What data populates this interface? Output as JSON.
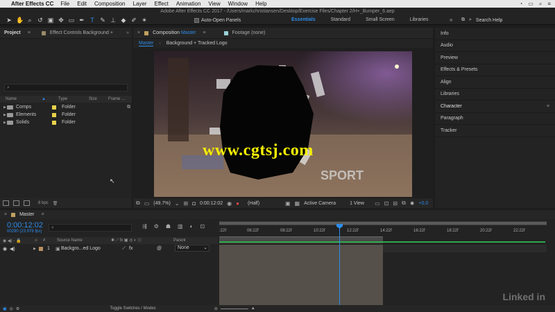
{
  "menubar": {
    "app": "After Effects CC",
    "items": [
      "File",
      "Edit",
      "Composition",
      "Layer",
      "Effect",
      "Animation",
      "View",
      "Window",
      "Help"
    ]
  },
  "toolbar": {
    "title": "Adobe After Effects CC 2017 - /Users/markchristiansen/Desktop/Exercise Files/Chapter 2/H+_Bumper_6.aep",
    "auto_open": "Auto-Open Panels",
    "workspaces": [
      "Essentials",
      "Standard",
      "Small Screen",
      "Libraries"
    ],
    "search_help": "Search Help"
  },
  "project": {
    "tab_project": "Project",
    "tab_effects": "Effect Controls Background +",
    "columns": [
      "Name",
      "Type",
      "Size",
      "Frame ..."
    ],
    "rows": [
      {
        "name": "Comps",
        "type": "Folder"
      },
      {
        "name": "Elements",
        "type": "Folder"
      },
      {
        "name": "Solids",
        "type": "Folder"
      }
    ],
    "bpc": "8 bpc"
  },
  "comp": {
    "tab_prefix": "Composition",
    "tab_name": "Master",
    "footage_tab": "Footage (none)",
    "crumb_master": "Master",
    "crumb_child": "Background + Tracked Logo",
    "zoom": "(49.7%)",
    "timecode": "0:00:12:02",
    "resolution": "(Half)",
    "camera": "Active Camera",
    "views": "1 View",
    "exposure": "+0.0"
  },
  "right_panels": [
    "Info",
    "Audio",
    "Preview",
    "Effects & Presets",
    "Align",
    "Libraries",
    "Character",
    "Paragraph",
    "Tracker"
  ],
  "timeline": {
    "tab": "Master",
    "timecode": "0:00:12:02",
    "fps": "00290 (23.976 fps)",
    "cols": [
      "Source Name",
      "Parent"
    ],
    "layer_num": "1",
    "layer_name": "Backgro...ed Logo",
    "parent_value": "None",
    "ticks": [
      ":22f",
      "06:22f",
      "08:22f",
      "10:22f",
      "12:22f",
      "14:22f",
      "16:22f",
      "18:22f",
      "20:22f",
      "22:22f"
    ],
    "footer": "Toggle Switches / Modes"
  },
  "watermark": "www.cgtsj.com",
  "linkedin": "Linked in"
}
